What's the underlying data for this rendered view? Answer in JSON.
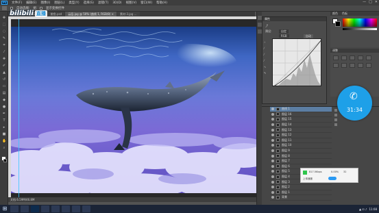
{
  "window": {
    "app_logo": "Ps",
    "menu": [
      "文件(F)",
      "编辑(E)",
      "图像(I)",
      "图层(L)",
      "类型(Y)",
      "选择(S)",
      "滤镜(T)",
      "3D(D)",
      "视图(V)",
      "窗口(W)",
      "帮助(H)"
    ],
    "controls": [
      "—",
      "□",
      "✕"
    ]
  },
  "options": {
    "items": [
      "自动选择:",
      "组",
      "显示变换控件"
    ]
  },
  "tabs": [
    "未标题-1.psd @ 33.3% ...",
    "鲸鱼.psd",
    "云层.jpg @ 50% (曲线 1, RGB/8) ×",
    "素材-3.jpg ..."
  ],
  "overlay": {
    "logo_text": "bilibili",
    "logo_badge": "直播"
  },
  "canvas": {
    "status": "文档:6.59M/46.8M"
  },
  "props_panel": {
    "title": "属性",
    "preset_label": "预设:",
    "preset_value": "自定",
    "channel_value": "RGB",
    "auto_label": "自动"
  },
  "color_panel": {
    "tab1": "颜色",
    "tab2": "色板"
  },
  "adjust_panel": {
    "title": "调整"
  },
  "layers": {
    "items": [
      "曲线 1",
      "图层 16",
      "图层 15",
      "图层 14",
      "图层 13",
      "图层 12",
      "图层 11",
      "图层 10",
      "图层 9",
      "图层 8",
      "图层 7",
      "图层 6",
      "图层 5",
      "图层 4",
      "图层 3",
      "图层 2",
      "图层 1",
      "背景"
    ]
  },
  "perf": {
    "label": "上传速度",
    "fps": "817.5Kbps",
    "cpu": "0.00%",
    "mem": "32",
    "toggle_label": "开"
  },
  "call": {
    "time": "31:34"
  },
  "taskbar": {
    "clock": "11:08",
    "date": "2017/10/23"
  }
}
